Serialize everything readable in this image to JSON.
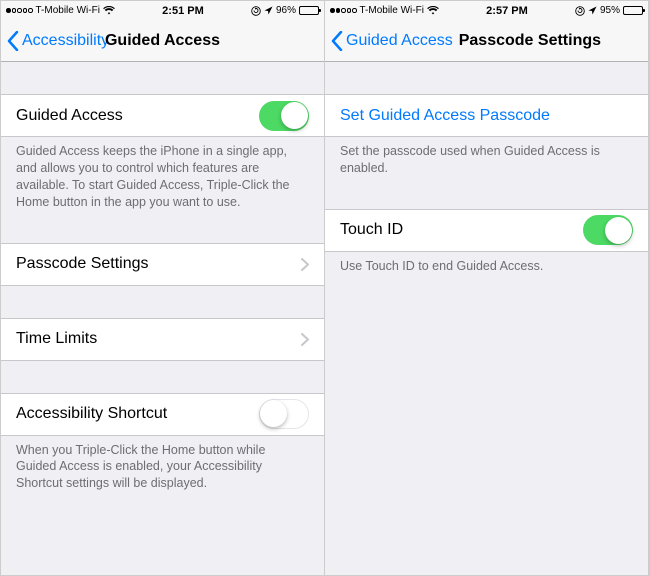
{
  "left": {
    "status": {
      "carrier": "T-Mobile Wi-Fi",
      "time": "2:51 PM",
      "battery_pct": "96%",
      "filled_dots": 1
    },
    "nav": {
      "back_label": "Accessibility",
      "title": "Guided Access"
    },
    "rows": {
      "guided_access_label": "Guided Access",
      "guided_access_on": true,
      "guided_access_desc": "Guided Access keeps the iPhone in a single app, and allows you to control which features are available. To start Guided Access, Triple-Click the Home button in the app you want to use.",
      "passcode_settings_label": "Passcode Settings",
      "time_limits_label": "Time Limits",
      "accessibility_shortcut_label": "Accessibility Shortcut",
      "accessibility_shortcut_on": false,
      "accessibility_shortcut_desc": "When you Triple-Click the Home button while Guided Access is enabled, your Accessibility Shortcut settings will be displayed."
    }
  },
  "right": {
    "status": {
      "carrier": "T-Mobile Wi-Fi",
      "time": "2:57 PM",
      "battery_pct": "95%",
      "filled_dots": 2
    },
    "nav": {
      "back_label": "Guided Access",
      "title": "Passcode Settings"
    },
    "rows": {
      "set_passcode_label": "Set Guided Access Passcode",
      "set_passcode_desc": "Set the passcode used when Guided Access is enabled.",
      "touch_id_label": "Touch ID",
      "touch_id_on": true,
      "touch_id_desc": "Use Touch ID to end Guided Access."
    }
  }
}
